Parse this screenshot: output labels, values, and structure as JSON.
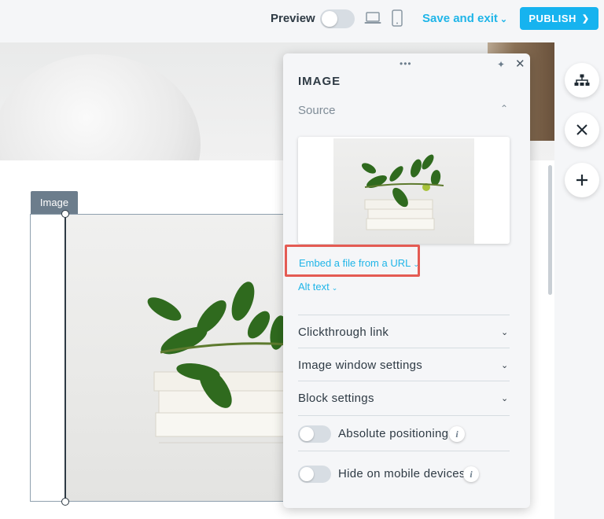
{
  "topbar": {
    "preview_label": "Preview",
    "save_exit_label": "Save and exit",
    "publish_label": "PUBLISH"
  },
  "canvas": {
    "image_tag": "Image"
  },
  "panel": {
    "title": "IMAGE",
    "source_label": "Source",
    "embed_link": "Embed a file from a URL",
    "alt_text_link": "Alt text",
    "rows": {
      "clickthrough": "Clickthrough link",
      "window_settings": "Image window settings",
      "block_settings": "Block settings",
      "absolute_positioning": "Absolute positioning",
      "hide_mobile": "Hide on mobile devices"
    }
  },
  "colors": {
    "accent": "#1fb5e8",
    "publish_bg": "#16b3ef",
    "highlight": "#e45b53"
  },
  "icons": {
    "laptop": "laptop-icon",
    "phone": "phone-icon",
    "sitemap": "sitemap-icon",
    "close": "close-icon",
    "plus": "plus-icon"
  }
}
